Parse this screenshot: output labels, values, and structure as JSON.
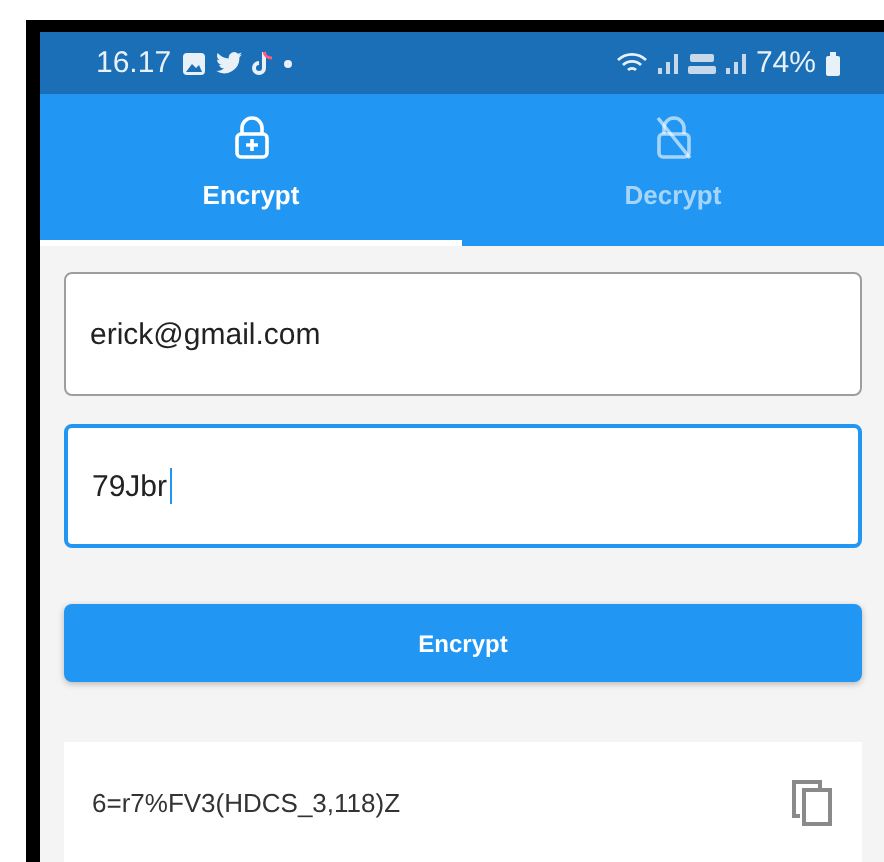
{
  "status_bar": {
    "time": "16.17",
    "battery": "74%"
  },
  "tabs": [
    {
      "label": "Encrypt",
      "kind": "encrypt",
      "selected": true
    },
    {
      "label": "Decrypt",
      "kind": "decrypt",
      "selected": false
    }
  ],
  "fields": [
    {
      "value": "erick@gmail.com",
      "focused": false
    },
    {
      "value": "79Jbr",
      "focused": true
    }
  ],
  "button": "Encrypt",
  "result": "6=r7%FV3(HDCS_3,118)Z"
}
